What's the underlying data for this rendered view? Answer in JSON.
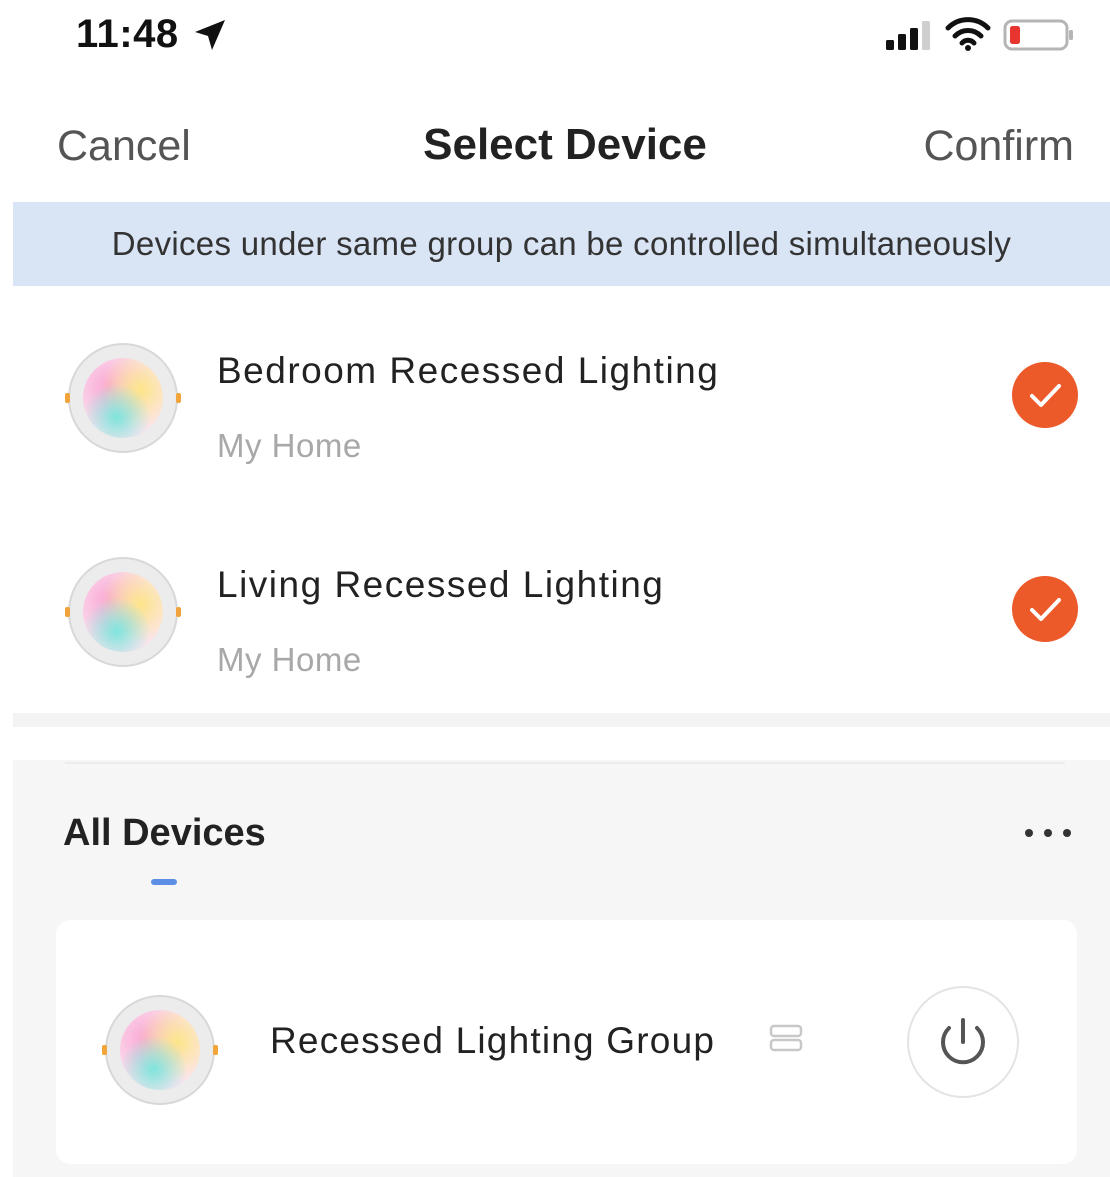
{
  "status_bar": {
    "time": "11:48",
    "icons": [
      "location-arrow-icon",
      "cellular-signal-icon",
      "wifi-icon",
      "battery-low-icon"
    ]
  },
  "nav": {
    "cancel_label": "Cancel",
    "title": "Select Device",
    "confirm_label": "Confirm"
  },
  "info_banner": {
    "text": "Devices under same group can be controlled simultaneously"
  },
  "devices": [
    {
      "name": "Bedroom Recessed Lighting",
      "home": "My Home",
      "selected": true
    },
    {
      "name": "Living Recessed Lighting",
      "home": "My Home",
      "selected": true
    }
  ],
  "background_app": {
    "tab_label": "All Devices",
    "group": {
      "name": "Recessed Lighting Group"
    }
  },
  "colors": {
    "accent_orange": "#ec5a2a",
    "banner_blue": "#d9e4f5",
    "tab_indicator": "#5c8ee6",
    "battery_red": "#e8352f"
  }
}
